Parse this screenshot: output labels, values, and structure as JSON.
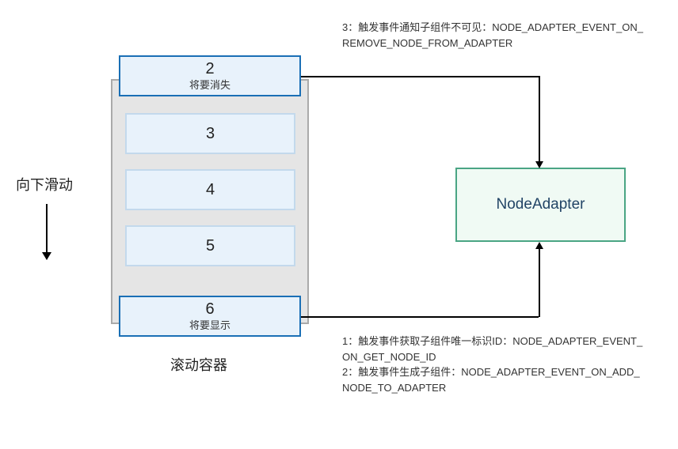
{
  "scroll": {
    "label": "向下滑动"
  },
  "container": {
    "label": "滚动容器",
    "items": [
      {
        "num": "2",
        "sub": "将要消失"
      },
      {
        "num": "3",
        "sub": ""
      },
      {
        "num": "4",
        "sub": ""
      },
      {
        "num": "5",
        "sub": ""
      },
      {
        "num": "6",
        "sub": "将要显示"
      }
    ]
  },
  "adapter": {
    "label": "NodeAdapter"
  },
  "annotations": {
    "top": "3：触发事件通知子组件不可见：NODE_ADAPTER_EVENT_ON_REMOVE_NODE_FROM_ADAPTER",
    "bottom": "1：触发事件获取子组件唯一标识ID：NODE_ADAPTER_EVENT_ON_GET_NODE_ID\n2：触发事件生成子组件：NODE_ADAPTER_EVENT_ON_ADD_NODE_TO_ADAPTER"
  }
}
